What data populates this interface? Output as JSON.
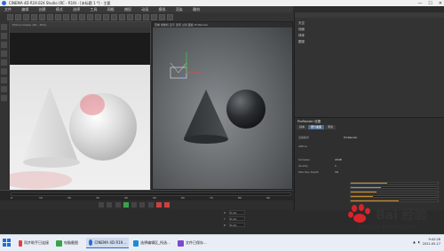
{
  "window": {
    "title": "CINEMA 4D R19.024 Studio (RC - R19) - [未标题 1 *] - 主要",
    "controls": [
      "—",
      "☐",
      "✕"
    ]
  },
  "menu": [
    "文件",
    "编辑",
    "创建",
    "模式",
    "选择",
    "工具",
    "网格",
    "捕捉",
    "动画",
    "模拟",
    "渲染",
    "雕刻"
  ],
  "render_window": {
    "title": "Picture Viewer (RC - R19)"
  },
  "viewport": {
    "header": "查看 摄像机 显示 选项 过滤 面板 ProRender",
    "label": "透视视图"
  },
  "object_manager": {
    "rows": [
      "天空",
      "地面",
      "球体",
      "圆锥"
    ]
  },
  "attributes": {
    "title": "ProRender 设置",
    "tabs": [
      "基本",
      "细分曲面",
      "离线"
    ],
    "active_tab_index": 1,
    "rows": [
      {
        "label": "渲染模式",
        "value": "ProRender"
      },
      {
        "label": "Offline",
        "value": ""
      },
      {
        "label": "Samples",
        "value": "2048"
      },
      {
        "label": "Quality",
        "value": "1"
      },
      {
        "label": "Max Ray Depth",
        "value": "10"
      }
    ],
    "sliders": [
      0.42,
      0.35,
      0.3,
      0.25,
      0.55
    ]
  },
  "timeline": {
    "frames": [
      "0",
      "10",
      "20",
      "30",
      "40",
      "50",
      "60",
      "70",
      "80",
      "90"
    ]
  },
  "coords": {
    "labels": [
      "X",
      "Y",
      "Z"
    ],
    "values": [
      "0 cm",
      "0 cm",
      "0 cm"
    ]
  },
  "taskbar": {
    "items": [
      {
        "label": "同步助手已连接",
        "color": "#e04040"
      },
      {
        "label": "电脑截图",
        "color": "#3aa34a"
      },
      {
        "label": "CINEMA 4D R19...",
        "color": "#2b6dd8",
        "active": true
      },
      {
        "label": "选择编辑区_所选...",
        "color": "#1f8ad6"
      },
      {
        "label": "文件已保存...",
        "color": "#7a4bd1"
      }
    ],
    "time": "9:42:28",
    "date": "2022-05-17"
  },
  "watermark": {
    "brand": "Bai 经验",
    "url": "jingyan.baidu.com"
  }
}
